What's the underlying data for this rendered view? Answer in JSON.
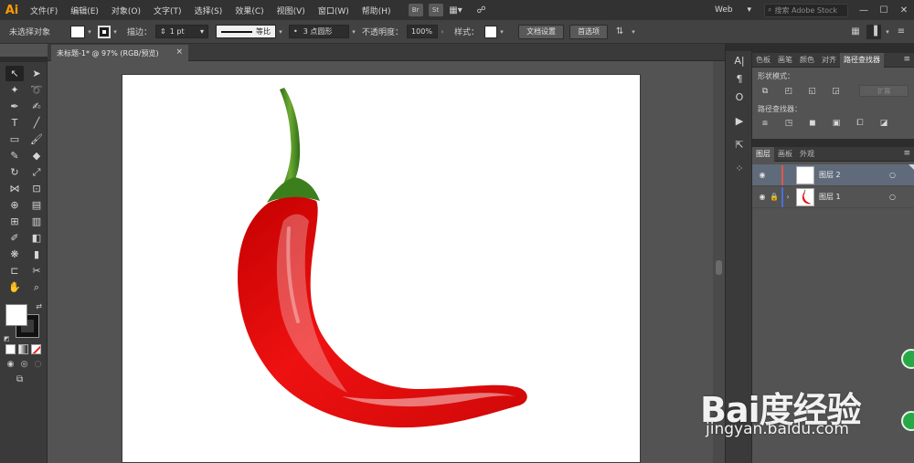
{
  "app": {
    "logo": "Ai",
    "menu": [
      "文件(F)",
      "编辑(E)",
      "对象(O)",
      "文字(T)",
      "选择(S)",
      "效果(C)",
      "视图(V)",
      "窗口(W)",
      "帮助(H)"
    ],
    "menu_icons": [
      "Br",
      "St"
    ],
    "workspace": "Web",
    "stock_search_placeholder": "搜索 Adobe Stock"
  },
  "control_bar": {
    "selection_status": "未选择对象",
    "stroke_label": "描边：",
    "stroke_weight": "1 pt",
    "stroke_profile": "等比",
    "brush": "3 点圆形",
    "opacity_label": "不透明度：",
    "opacity_value": "100%",
    "style_label": "样式：",
    "document_setup": "文档设置",
    "preferences": "首选项"
  },
  "document": {
    "tab_title": "未标题-1* @ 97% (RGB/预览)",
    "close_glyph": "×"
  },
  "pathfinder_panel": {
    "tabs": [
      "色板",
      "画笔",
      "颜色",
      "对齐",
      "路径查找器"
    ],
    "active_tab": "路径查找器",
    "shape_modes_label": "形状模式：",
    "pathfinders_label": "路径查找器：",
    "expand_label": "扩展"
  },
  "layers_panel": {
    "tabs": [
      "图层",
      "画板",
      "外观"
    ],
    "active_tab": "图层",
    "layers": [
      {
        "name": "图层 2",
        "color": "#e0564a",
        "selected": true,
        "locked": false,
        "has_expander": false
      },
      {
        "name": "图层 1",
        "color": "#4a6fe0",
        "selected": false,
        "locked": true,
        "has_expander": true
      }
    ]
  },
  "watermark": {
    "logo": "Bai度经验",
    "url": "jingyan.baidu.com"
  },
  "colors": {
    "accent_orange": "#ff9a00",
    "pepper_red": "#e01010",
    "stem_green": "#3f8a1f",
    "selection_blue": "#5f6b7a"
  }
}
